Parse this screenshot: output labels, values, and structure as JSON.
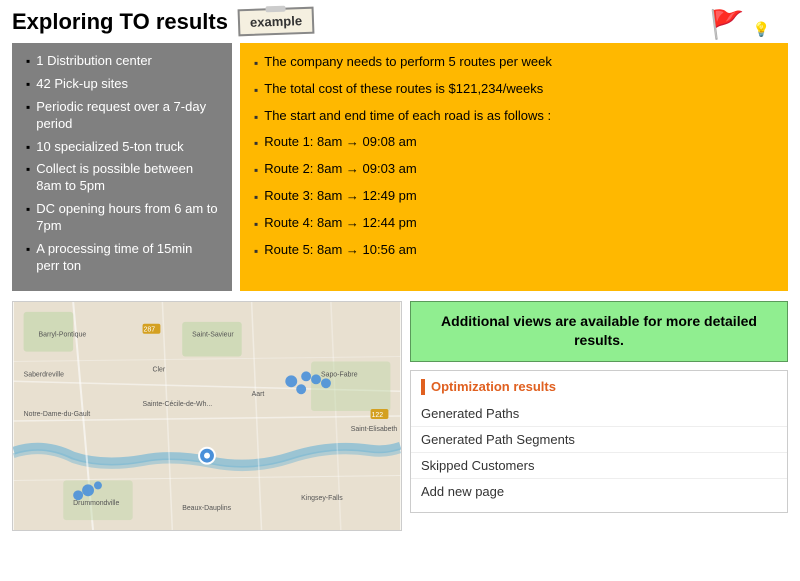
{
  "header": {
    "title": "Exploring TO results",
    "example_label": "example"
  },
  "left_panel": {
    "items": [
      "1 Distribution center",
      "42 Pick-up sites",
      "Periodic request over a 7-day period",
      "10 specialized 5-ton truck",
      "Collect is possible between 8am to 5pm",
      "DC opening hours from 6 am to 7pm",
      "A processing time of 15min perr ton"
    ]
  },
  "right_panel": {
    "items": [
      "The company needs to perform 5 routes per week",
      "The total cost of these routes is $121,234/weeks",
      "The start and end time of each road is as follows :"
    ],
    "routes": [
      "Route 1: 8am → 09:08 am",
      "Route 2: 8am → 09:03 am",
      "Route 3: 8am → 12:49 pm",
      "Route 4: 8am → 12:44 pm",
      "Route 5: 8am → 10:56 am"
    ]
  },
  "additional_views": {
    "text": "Additional views are available for more detailed results."
  },
  "optimization_results": {
    "title": "Optimization results",
    "items": [
      "Generated Paths",
      "Generated Path Segments",
      "Skipped Customers",
      "Add new page"
    ]
  },
  "icons": {
    "flag": "🚩",
    "lightbulb": "💡"
  }
}
